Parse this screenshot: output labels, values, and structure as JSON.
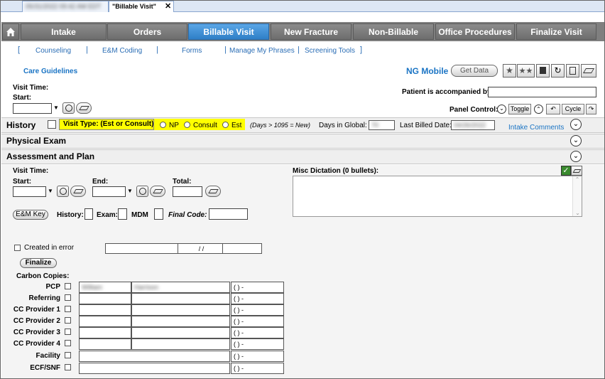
{
  "tabs": [
    {
      "label": "05/31/2022 09:42 AM EDT"
    },
    {
      "label": "\"Billable Visit\"",
      "close": "✕"
    }
  ],
  "nav": {
    "home_icon": "home-icon",
    "items": [
      {
        "label": "Intake"
      },
      {
        "label": "Orders"
      },
      {
        "label": "Billable Visit"
      },
      {
        "label": "New Fracture"
      },
      {
        "label": "Non-Billable"
      },
      {
        "label": "Office Procedures"
      },
      {
        "label": "Finalize Visit"
      }
    ]
  },
  "subnav": {
    "items": [
      {
        "label": "Counseling"
      },
      {
        "label": "E&M Coding"
      },
      {
        "label": "Forms"
      },
      {
        "label": "Manage My Phrases"
      },
      {
        "label": "Screening Tools"
      }
    ]
  },
  "header": {
    "care_guidelines": "Care Guidelines",
    "ng_mobile": "NG Mobile",
    "get_data": "Get Data",
    "visit_time": "Visit Time:",
    "start": "Start:",
    "accompanied_label": "Patient is accompanied by:",
    "panel_control": "Panel Control:",
    "toggle": "Toggle",
    "cycle": "Cycle"
  },
  "history": {
    "title": "History",
    "visit_type_label": "Visit Type: (Est or Consult)",
    "np": "NP",
    "consult": "Consult",
    "est": "Est",
    "days_note": "(Days > 1095 = New)",
    "days_in_global": "Days in Global:",
    "days_value": "70",
    "last_billed": "Last Billed Date:",
    "last_billed_value": "04/26/2022",
    "intake_comments": "Intake Comments"
  },
  "sections": {
    "physical_exam": "Physical Exam",
    "assessment": "Assessment and Plan"
  },
  "visit": {
    "visit_time": "Visit Time:",
    "start": "Start:",
    "end": "End:",
    "total": "Total:",
    "misc_dictation": "Misc Dictation (0 bullets):",
    "em_key": "E&M Key",
    "history": "History:",
    "exam": "Exam:",
    "mdm": "MDM",
    "final_code": "Final Code:"
  },
  "footer": {
    "created_in_error": "Created in error",
    "date_sep": "/ /",
    "finalize": "Finalize",
    "carbon_copies": "Carbon Copies:",
    "phone_placeholder": "(  )  -",
    "rows": [
      {
        "label": "PCP",
        "first": "William",
        "last": "Harrison"
      },
      {
        "label": "Referring",
        "first": "",
        "last": ""
      },
      {
        "label": "CC Provider 1",
        "first": "",
        "last": ""
      },
      {
        "label": "CC Provider 2",
        "first": "",
        "last": ""
      },
      {
        "label": "CC Provider 3",
        "first": "",
        "last": ""
      },
      {
        "label": "CC Provider 4",
        "first": "",
        "last": ""
      },
      {
        "label": "Facility",
        "first": "",
        "last": ""
      },
      {
        "label": "ECF/SNF",
        "first": "",
        "last": ""
      }
    ]
  },
  "colors": {
    "nav_active": "#2f7fc7",
    "highlight": "#ffff00",
    "link": "#1a74c4"
  }
}
